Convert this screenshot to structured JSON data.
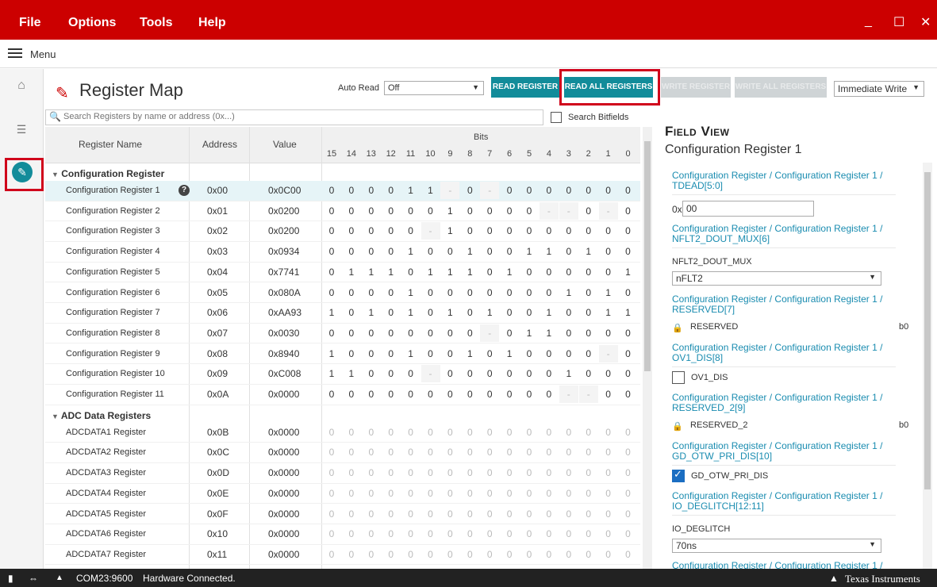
{
  "menubar": {
    "items": [
      "File",
      "Options",
      "Tools",
      "Help"
    ],
    "minimize": "_",
    "maximize": "☐",
    "close": "✕"
  },
  "menu": {
    "label": "Menu"
  },
  "header": {
    "title": "Register Map",
    "auto_read_label": "Auto Read",
    "auto_read_value": "Off",
    "read_register": "READ REGISTER",
    "read_all": "READ ALL REGISTERS",
    "write_register": "WRITE REGISTER",
    "write_all": "WRITE ALL REGISTERS",
    "write_mode": "Immediate Write"
  },
  "search": {
    "placeholder": "Search Registers by name or address (0x...)",
    "bitfields_label": "Search Bitfields"
  },
  "grid": {
    "col_name": "Register Name",
    "col_address": "Address",
    "col_value": "Value",
    "col_bits": "Bits",
    "bit_numbers": [
      "15",
      "14",
      "13",
      "12",
      "11",
      "10",
      "9",
      "8",
      "7",
      "6",
      "5",
      "4",
      "3",
      "2",
      "1",
      "0"
    ],
    "groups": [
      {
        "name": "Configuration Register",
        "rows": [
          {
            "name": "Configuration Register 1",
            "address": "0x00",
            "value": "0x0C00",
            "bits": [
              "0",
              "0",
              "0",
              "0",
              "1",
              "1",
              "-",
              "0",
              "-",
              "0",
              "0",
              "0",
              "0",
              "0",
              "0",
              "0"
            ]
          },
          {
            "name": "Configuration Register 2",
            "address": "0x01",
            "value": "0x0200",
            "bits": [
              "0",
              "0",
              "0",
              "0",
              "0",
              "0",
              "1",
              "0",
              "0",
              "0",
              "0",
              "-",
              "-",
              "0",
              "-",
              "0"
            ]
          },
          {
            "name": "Configuration Register 3",
            "address": "0x02",
            "value": "0x0200",
            "bits": [
              "0",
              "0",
              "0",
              "0",
              "0",
              "-",
              "1",
              "0",
              "0",
              "0",
              "0",
              "0",
              "0",
              "0",
              "0",
              "0"
            ]
          },
          {
            "name": "Configuration Register 4",
            "address": "0x03",
            "value": "0x0934",
            "bits": [
              "0",
              "0",
              "0",
              "0",
              "1",
              "0",
              "0",
              "1",
              "0",
              "0",
              "1",
              "1",
              "0",
              "1",
              "0",
              "0"
            ]
          },
          {
            "name": "Configuration Register 5",
            "address": "0x04",
            "value": "0x7741",
            "bits": [
              "0",
              "1",
              "1",
              "1",
              "0",
              "1",
              "1",
              "1",
              "0",
              "1",
              "0",
              "0",
              "0",
              "0",
              "0",
              "1"
            ]
          },
          {
            "name": "Configuration Register 6",
            "address": "0x05",
            "value": "0x080A",
            "bits": [
              "0",
              "0",
              "0",
              "0",
              "1",
              "0",
              "0",
              "0",
              "0",
              "0",
              "0",
              "0",
              "1",
              "0",
              "1",
              "0"
            ]
          },
          {
            "name": "Configuration Register 7",
            "address": "0x06",
            "value": "0xAA93",
            "bits": [
              "1",
              "0",
              "1",
              "0",
              "1",
              "0",
              "1",
              "0",
              "1",
              "0",
              "0",
              "1",
              "0",
              "0",
              "1",
              "1"
            ]
          },
          {
            "name": "Configuration Register 8",
            "address": "0x07",
            "value": "0x0030",
            "bits": [
              "0",
              "0",
              "0",
              "0",
              "0",
              "0",
              "0",
              "0",
              "-",
              "0",
              "1",
              "1",
              "0",
              "0",
              "0",
              "0"
            ]
          },
          {
            "name": "Configuration Register 9",
            "address": "0x08",
            "value": "0x8940",
            "bits": [
              "1",
              "0",
              "0",
              "0",
              "1",
              "0",
              "0",
              "1",
              "0",
              "1",
              "0",
              "0",
              "0",
              "0",
              "-",
              "0"
            ]
          },
          {
            "name": "Configuration Register 10",
            "address": "0x09",
            "value": "0xC008",
            "bits": [
              "1",
              "1",
              "0",
              "0",
              "0",
              "-",
              "0",
              "0",
              "0",
              "0",
              "0",
              "0",
              "1",
              "0",
              "0",
              "0"
            ]
          },
          {
            "name": "Configuration Register 11",
            "address": "0x0A",
            "value": "0x0000",
            "bits": [
              "0",
              "0",
              "0",
              "0",
              "0",
              "0",
              "0",
              "0",
              "0",
              "0",
              "0",
              "0",
              "-",
              "-",
              "0",
              "0"
            ]
          }
        ]
      },
      {
        "name": "ADC Data Registers",
        "rows": [
          {
            "name": "ADCDATA1 Register",
            "address": "0x0B",
            "value": "0x0000"
          },
          {
            "name": "ADCDATA2 Register",
            "address": "0x0C",
            "value": "0x0000"
          },
          {
            "name": "ADCDATA3 Register",
            "address": "0x0D",
            "value": "0x0000"
          },
          {
            "name": "ADCDATA4 Register",
            "address": "0x0E",
            "value": "0x0000"
          },
          {
            "name": "ADCDATA5 Register",
            "address": "0x0F",
            "value": "0x0000"
          },
          {
            "name": "ADCDATA6 Register",
            "address": "0x10",
            "value": "0x0000"
          },
          {
            "name": "ADCDATA7 Register",
            "address": "0x11",
            "value": "0x0000"
          }
        ]
      }
    ]
  },
  "field_view": {
    "title": "Field View",
    "subtitle": "Configuration Register 1",
    "tdead_link": "Configuration Register / Configuration Register 1 / TDEAD[5:0]",
    "tdead_prefix": "0x",
    "tdead_value": "00",
    "nflt2_link": "Configuration Register / Configuration Register 1 / NFLT2_DOUT_MUX[6]",
    "nflt2_label": "NFLT2_DOUT_MUX",
    "nflt2_value": "nFLT2",
    "reserved_link": "Configuration Register / Configuration Register 1 / RESERVED[7]",
    "reserved_label": "RESERVED",
    "reserved_value": "b0",
    "ov1_link": "Configuration Register / Configuration Register 1 / OV1_DIS[8]",
    "ov1_label": "OV1_DIS",
    "reserved2_link": "Configuration Register / Configuration Register 1 / RESERVED_2[9]",
    "reserved2_label": "RESERVED_2",
    "reserved2_value": "b0",
    "gdotw_link": "Configuration Register / Configuration Register 1 / GD_OTW_PRI_DIS[10]",
    "gdotw_label": "GD_OTW_PRI_DIS",
    "iodeg_link": "Configuration Register / Configuration Register 1 / IO_DEGLITCH[12:11]",
    "iodeg_label": "IO_DEGLITCH",
    "iodeg_value": "70ns",
    "last_link": "Configuration Register / Configuration Register 1 /"
  },
  "status": {
    "port": "COM23:9600",
    "conn": "Hardware Connected.",
    "brand": "Texas Instruments"
  }
}
